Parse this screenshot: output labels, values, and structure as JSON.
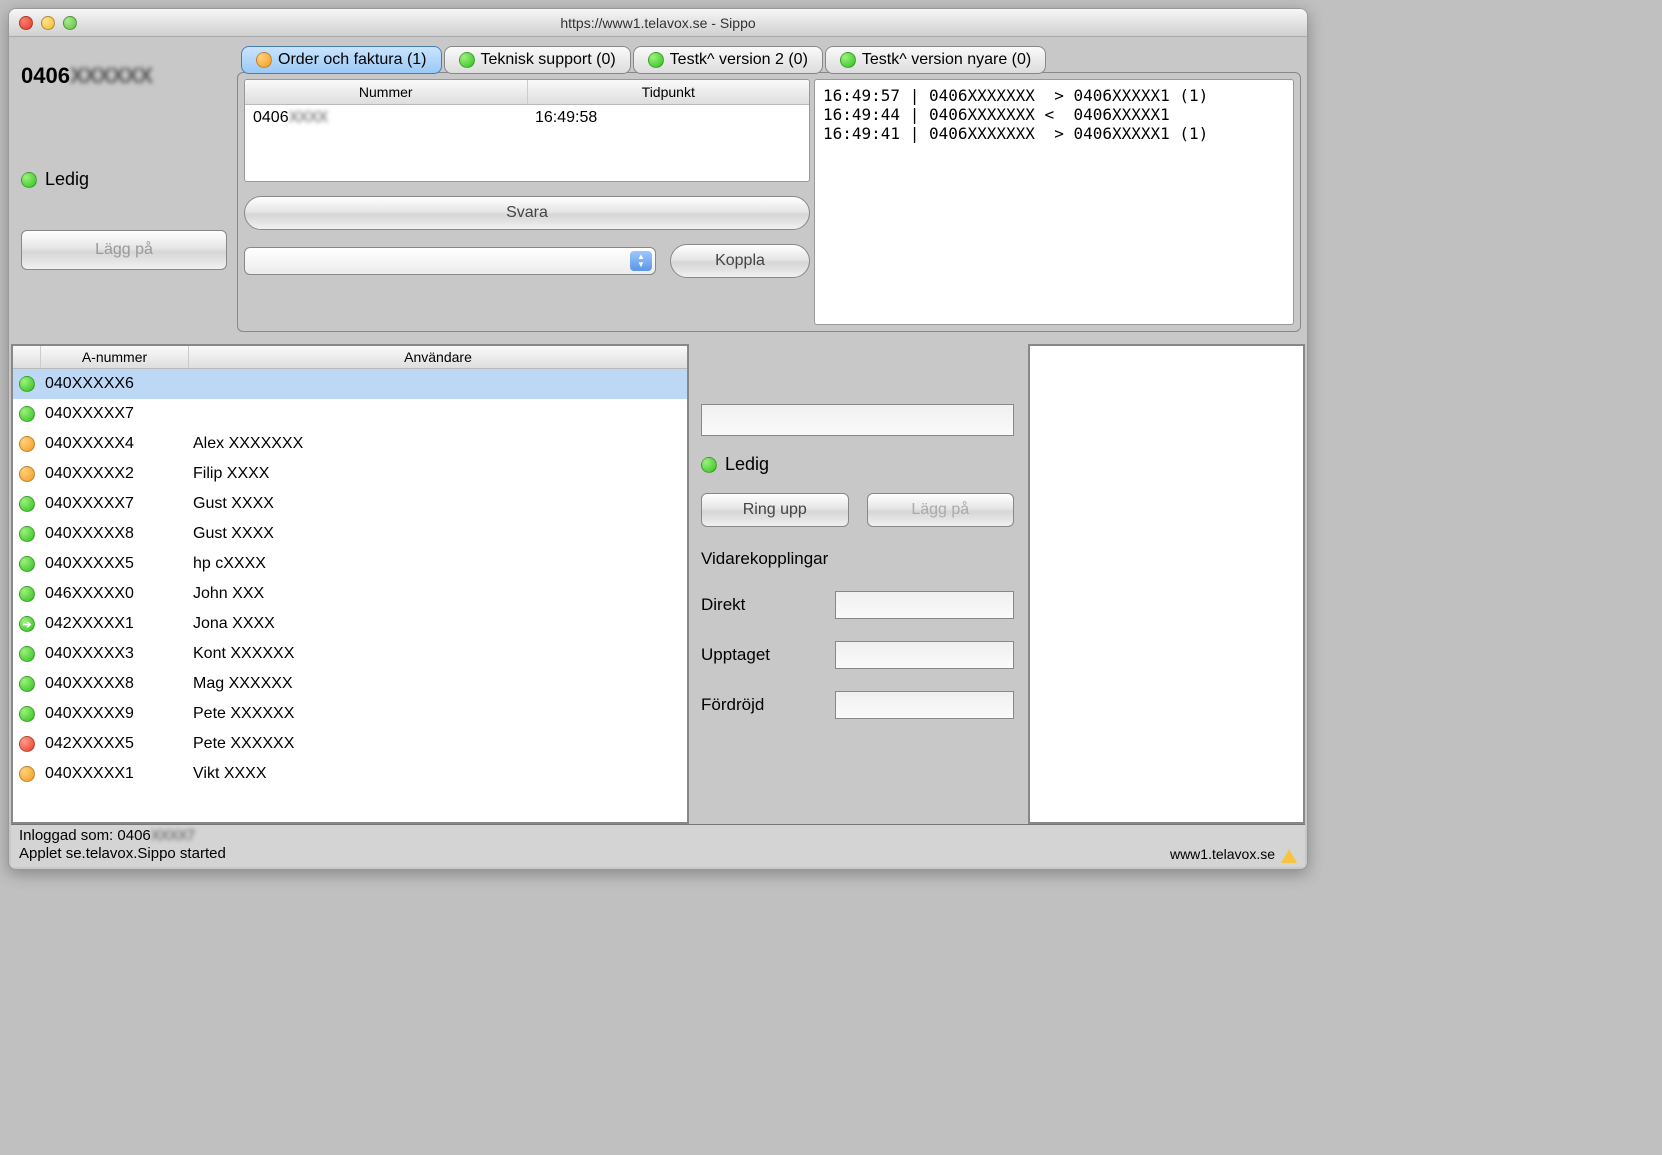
{
  "window": {
    "title": "https://www1.telavox.se - Sippo"
  },
  "sidebar": {
    "number_prefix": "0406",
    "number_obscured": "XXXXXX",
    "status_label": "Ledig",
    "hangup_label": "Lägg på"
  },
  "tabs": [
    {
      "label": "Order och faktura (1)",
      "color": "orange",
      "active": true
    },
    {
      "label": "Teknisk support (0)",
      "color": "green",
      "active": false
    },
    {
      "label": "Testk^ version 2 (0)",
      "color": "green",
      "active": false
    },
    {
      "label": "Testk^ version nyare (0)",
      "color": "green",
      "active": false
    }
  ],
  "call_table": {
    "headers": [
      "Nummer",
      "Tidpunkt"
    ],
    "rows": [
      {
        "nummer_prefix": "0406",
        "nummer_obscured": "XXXX",
        "tidpunkt": "16:49:58"
      }
    ]
  },
  "log_lines": [
    "16:49:57 | 0406XXXXXXX  > 0406XXXXX1 (1)",
    "16:49:44 | 0406XXXXXXX <  0406XXXXX1",
    "16:49:41 | 0406XXXXXXX  > 0406XXXXX1 (1)"
  ],
  "answer_button": "Svara",
  "transfer_button": "Koppla",
  "user_table": {
    "headers": {
      "status": "",
      "anummer": "A-nummer",
      "anvandare": "Användare"
    },
    "rows": [
      {
        "status": "green",
        "anummer": "040XXXXX6",
        "anvandare": "",
        "selected": true
      },
      {
        "status": "green",
        "anummer": "040XXXXX7",
        "anvandare": ""
      },
      {
        "status": "orange",
        "anummer": "040XXXXX4",
        "anvandare": "Alex XXXXXXX"
      },
      {
        "status": "orange",
        "anummer": "040XXXXX2",
        "anvandare": "Filip XXXX"
      },
      {
        "status": "green",
        "anummer": "040XXXXX7",
        "anvandare": "Gust XXXX"
      },
      {
        "status": "green",
        "anummer": "040XXXXX8",
        "anvandare": "Gust XXXX"
      },
      {
        "status": "green",
        "anummer": "040XXXXX5",
        "anvandare": "hp cXXXX"
      },
      {
        "status": "green",
        "anummer": "046XXXXX0",
        "anvandare": "John XXX"
      },
      {
        "status": "arrow",
        "anummer": "042XXXXX1",
        "anvandare": "Jona XXXX"
      },
      {
        "status": "green",
        "anummer": "040XXXXX3",
        "anvandare": "Kont XXXXXX"
      },
      {
        "status": "green",
        "anummer": "040XXXXX8",
        "anvandare": "Mag XXXXXX"
      },
      {
        "status": "green",
        "anummer": "040XXXXX9",
        "anvandare": "Pete XXXXXX"
      },
      {
        "status": "red",
        "anummer": "042XXXXX5",
        "anvandare": "Pete XXXXXX"
      },
      {
        "status": "orange",
        "anummer": "040XXXXX1",
        "anvandare": "Vikt XXXX"
      }
    ]
  },
  "detail": {
    "status_label": "Ledig",
    "ring_label": "Ring upp",
    "hangup_label": "Lägg på",
    "fwd_title": "Vidarekopplingar",
    "fwd_direct": "Direkt",
    "fwd_busy": "Upptaget",
    "fwd_delayed": "Fördröjd"
  },
  "statusbar": {
    "logged_in_prefix": "Inloggad som: 0406",
    "logged_in_obscured": "XXXX7",
    "applet_line": "Applet se.telavox.Sippo started",
    "host": "www1.telavox.se"
  }
}
